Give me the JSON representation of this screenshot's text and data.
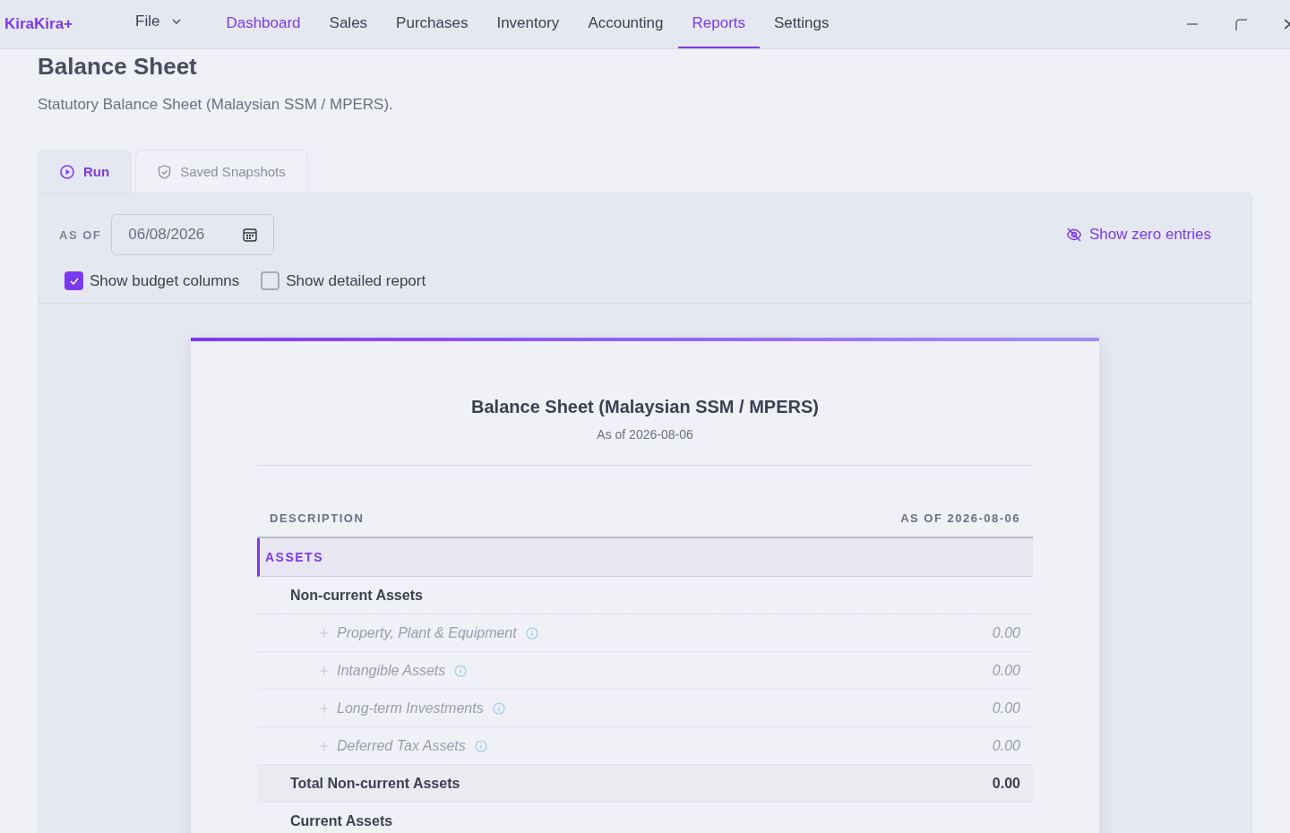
{
  "app": {
    "name": "KiraKira+"
  },
  "menu": [
    {
      "label": "File",
      "kind": "dropdown",
      "selected": false,
      "hovered": false
    },
    {
      "label": "Dashboard",
      "kind": "link",
      "selected": false,
      "hovered": true
    },
    {
      "label": "Sales",
      "kind": "link",
      "selected": false,
      "hovered": false
    },
    {
      "label": "Purchases",
      "kind": "link",
      "selected": false,
      "hovered": false
    },
    {
      "label": "Inventory",
      "kind": "link",
      "selected": false,
      "hovered": false
    },
    {
      "label": "Accounting",
      "kind": "link",
      "selected": false,
      "hovered": false
    },
    {
      "label": "Reports",
      "kind": "link",
      "selected": true,
      "hovered": false
    },
    {
      "label": "Settings",
      "kind": "link",
      "selected": false,
      "hovered": false
    }
  ],
  "page": {
    "title": "Balance Sheet",
    "subtitle": "Statutory Balance Sheet (Malaysian SSM / MPERS)."
  },
  "tabs": [
    {
      "label": "Run",
      "selected": true
    },
    {
      "label": "Saved Snapshots",
      "selected": false
    }
  ],
  "filters": {
    "as_of_label": "AS OF",
    "date": "06/08/2026",
    "zero_toggle": "Show zero entries",
    "checkboxes": [
      {
        "label": "Show budget columns",
        "checked": true
      },
      {
        "label": "Show detailed report",
        "checked": false
      }
    ]
  },
  "report": {
    "title": "Balance Sheet (Malaysian SSM / MPERS)",
    "subtitle": "As of 2026-08-06",
    "columns": [
      "DESCRIPTION",
      "AS OF 2026-08-06"
    ],
    "rows": [
      {
        "kind": "section",
        "label": "ASSETS"
      },
      {
        "kind": "group",
        "label": "Non-current Assets"
      },
      {
        "kind": "item",
        "label": "Property, Plant & Equipment",
        "amount": "0.00"
      },
      {
        "kind": "item",
        "label": "Intangible Assets",
        "amount": "0.00"
      },
      {
        "kind": "item",
        "label": "Long-term Investments",
        "amount": "0.00"
      },
      {
        "kind": "item",
        "label": "Deferred Tax Assets",
        "amount": "0.00"
      },
      {
        "kind": "total",
        "label": "Total Non-current Assets",
        "amount": "0.00"
      },
      {
        "kind": "group",
        "label": "Current Assets"
      }
    ]
  }
}
